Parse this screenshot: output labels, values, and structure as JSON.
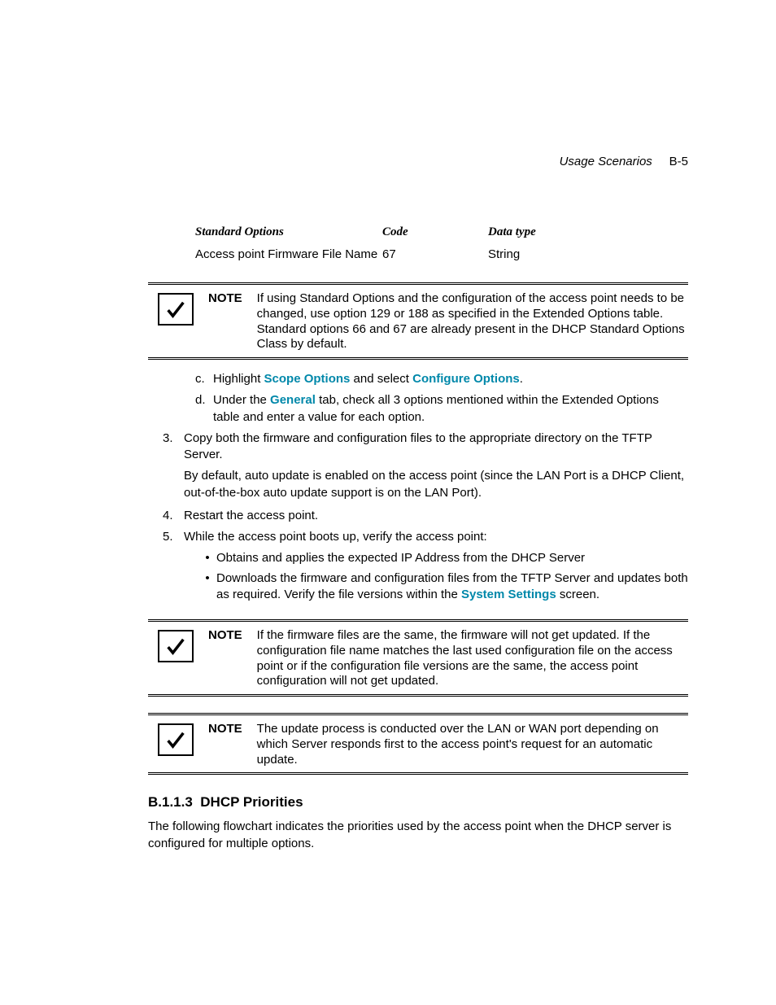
{
  "header": {
    "section": "Usage Scenarios",
    "page": "B-5"
  },
  "table": {
    "headers": {
      "c1": "Standard Options",
      "c2": "Code",
      "c3": "Data type"
    },
    "row": {
      "c1": "Access point Firmware File Name",
      "c2": "67",
      "c3": "String"
    }
  },
  "notes": {
    "label": "NOTE",
    "n1": "If using Standard Options and the configuration of the access point needs to be changed, use option 129 or 188 as specified in the Extended Options table. Standard options 66 and 67 are already present in the DHCP Standard Options Class by default.",
    "n2": "If the firmware files are the same, the firmware will not get updated. If the configuration file name matches the last used configuration file on the access point or if the configuration file versions are the same, the access point configuration will not get updated.",
    "n3": "The update process is conducted over the LAN or WAN port depending on which Server responds first to the access point's request for an automatic update."
  },
  "steps": {
    "c_pre": "Highlight ",
    "c_b1": "Scope Options",
    "c_mid": " and select ",
    "c_b2": "Configure Options",
    "c_end": ".",
    "d_pre": "Under the ",
    "d_b1": "General",
    "d_post": " tab, check all 3 options mentioned within the Extended Options table and enter a value for each option.",
    "s3": "Copy both the firmware and configuration files to the appropriate directory on the TFTP Server.",
    "s3b": "By default, auto update is enabled on the access point (since the LAN Port is a DHCP Client, out-of-the-box auto update support is on the LAN Port).",
    "s4": "Restart the access point.",
    "s5": "While the access point boots up, verify the access point:",
    "bul1": "Obtains and applies the expected IP Address from the DHCP Server",
    "bul2_pre": "Downloads the firmware and configuration files from the TFTP Server and updates both as required. Verify the file versions within the ",
    "bul2_b": "System Settings",
    "bul2_post": " screen."
  },
  "section": {
    "num": "B.1.1.3",
    "title": "DHCP Priorities",
    "para": "The following flowchart indicates the priorities used by the access point when the DHCP server is configured for multiple options."
  },
  "markers": {
    "c": "c.",
    "d": "d.",
    "n3": "3.",
    "n4": "4.",
    "n5": "5.",
    "bullet": "•"
  }
}
